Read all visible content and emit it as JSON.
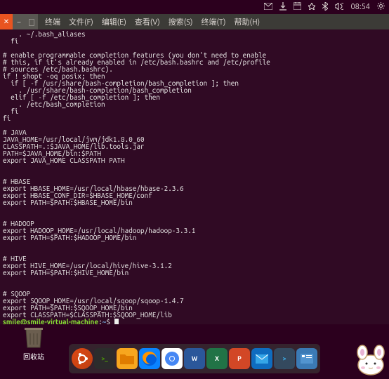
{
  "topbar": {
    "time": "08:54"
  },
  "menubar": {
    "title": "终端",
    "file": "文件(F)",
    "edit": "编辑(E)",
    "view": "查看(V)",
    "search": "搜索(S)",
    "terminal": "终端(T)",
    "help": "帮助(H)"
  },
  "terminal": {
    "lines": [
      "    . ~/.bash_aliases",
      "  fi",
      "",
      "# enable programmable completion features (you don't need to enable",
      "# this, if it's already enabled in /etc/bash.bashrc and /etc/profile",
      "# sources /etc/bash.bashrc).",
      "if ! shopt -oq posix; then",
      "  if [ -f /usr/share/bash-completion/bash_completion ]; then",
      "    . /usr/share/bash-completion/bash_completion",
      "  elif [ -f /etc/bash_completion ]; then",
      "    . /etc/bash_completion",
      "  fi",
      "fi",
      "",
      "# JAVA",
      "JAVA_HOME=/usr/local/jvm/jdk1.8.0_60",
      "CLASSPATH=.:$JAVA_HOME/lib.tools.jar",
      "PATH=$JAVA_HOME/bin:$PATH",
      "export JAVA_HOME CLASSPATH PATH",
      "",
      "",
      "# HBASE",
      "export HBASE_HOME=/usr/local/hbase/hbase-2.3.6",
      "export HBASE_CONF_DIR=$HBASE_HOME/conf",
      "export PATH=$PATH:$HBASE_HOME/bin",
      "",
      "",
      "# HADOOP",
      "export HADOOP_HOME=/usr/local/hadoop/hadoop-3.3.1",
      "export PATH=$PATH:$HADOOP_HOME/bin",
      "",
      "",
      "# HIVE",
      "export HIVE_HOME=/usr/local/hive/hive-3.1.2",
      "export PATH=$PATH:$HIVE_HOME/bin",
      "",
      "",
      "# SQOOP",
      "export SQOOP_HOME=/usr/local/sqoop/sqoop-1.4.7",
      "export PATH=$PATH:$SQOOP_HOME/bin",
      "export CLASSPATH=$CLASSPATH:$SQOOP_HOME/lib"
    ],
    "prompt": {
      "user": "smile@smile-virtual-machine",
      "sep": ":",
      "path": "~",
      "end": "$ "
    }
  },
  "desktop": {
    "trash": "回收站"
  },
  "dock": {
    "items": [
      "ubuntu",
      "terminal",
      "files",
      "firefox",
      "chromium",
      "word",
      "excel",
      "powerpoint",
      "mail",
      "terminal2",
      "settings"
    ]
  }
}
